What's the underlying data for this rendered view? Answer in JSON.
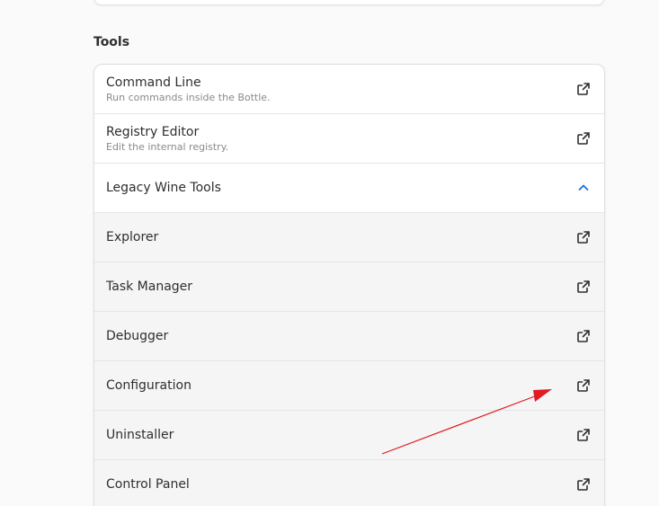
{
  "section": {
    "title": "Tools"
  },
  "tools": {
    "command_line": {
      "title": "Command Line",
      "subtitle": "Run commands inside the Bottle."
    },
    "registry_editor": {
      "title": "Registry Editor",
      "subtitle": "Edit the internal registry."
    },
    "legacy": {
      "title": "Legacy Wine Tools",
      "expanded": true,
      "items": [
        {
          "title": "Explorer"
        },
        {
          "title": "Task Manager"
        },
        {
          "title": "Debugger"
        },
        {
          "title": "Configuration"
        },
        {
          "title": "Uninstaller"
        },
        {
          "title": "Control Panel"
        }
      ]
    }
  },
  "icons": {
    "launch": "external-link-icon",
    "expander": "chevron-up-icon"
  },
  "colors": {
    "accent": "#1c71d8",
    "annotation": "#e01b24"
  }
}
